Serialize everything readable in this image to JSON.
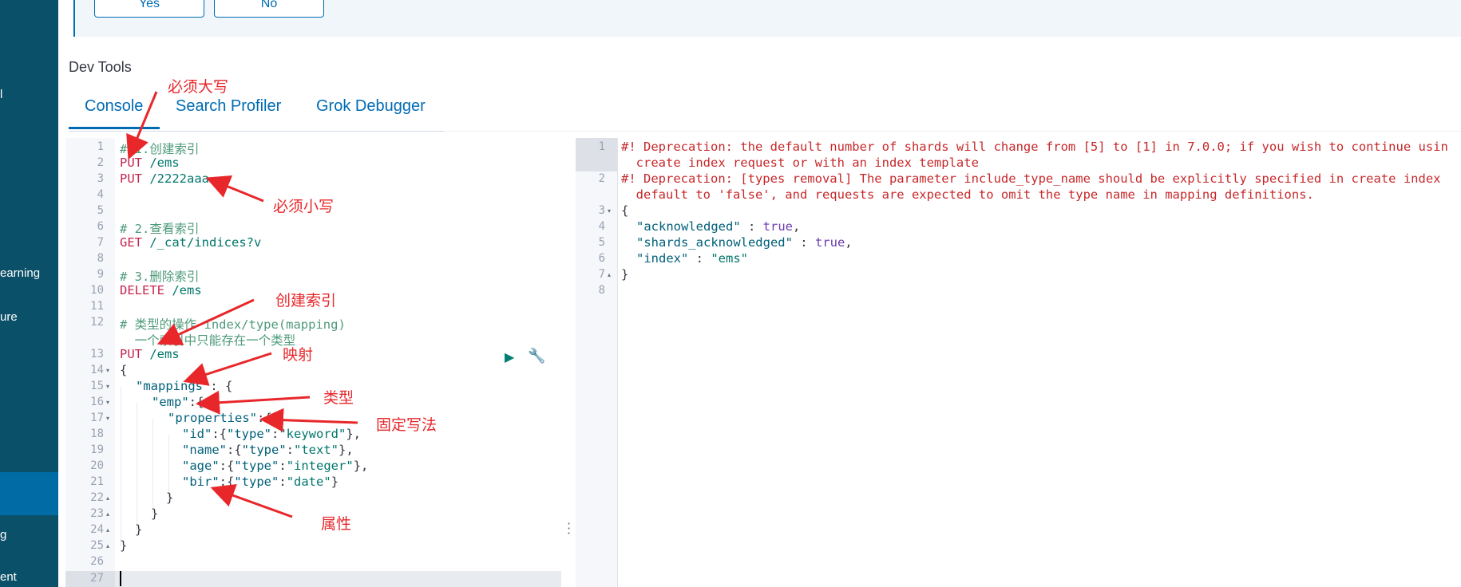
{
  "sidebar": {
    "items": [
      {
        "label": "l"
      },
      {
        "label": "earning"
      },
      {
        "label": "ure"
      },
      {
        "label": "g"
      },
      {
        "label": "ent"
      }
    ]
  },
  "callout": {
    "yes_label": "Yes",
    "no_label": "No"
  },
  "page_title": "Dev Tools",
  "tabs": [
    {
      "label": "Console"
    },
    {
      "label": "Search Profiler"
    },
    {
      "label": "Grok Debugger"
    }
  ],
  "request_editor": {
    "line_numbers": [
      "1",
      "2",
      "3",
      "4",
      "5",
      "6",
      "7",
      "8",
      "9",
      "10",
      "11",
      "12",
      "13",
      "14",
      "15",
      "16",
      "17",
      "18",
      "19",
      "20",
      "21",
      "22",
      "23",
      "24",
      "25",
      "26",
      "27"
    ],
    "lines": {
      "l1": "# 1.创建索引",
      "l2_method": "PUT",
      "l2_path": " /ems",
      "l3_method": "PUT",
      "l3_path": " /2222aaa",
      "l6": "# 2.查看索引",
      "l7_method": "GET",
      "l7_path": " /_cat/indices?v",
      "l9": "# 3.删除索引",
      "l10_method": "DELETE",
      "l10_path": " /ems",
      "l12a": "# 类型的操作 index/type(mapping)",
      "l12b": "  一个索引中只能存在一个类型",
      "l13_method": "PUT",
      "l13_path": " /ems",
      "l14": "{",
      "l15_key": "\"mappings\"",
      "l15_rest": ": {",
      "l16_key": "\"emp\"",
      "l16_rest": ":{",
      "l17_key": "\"properties\"",
      "l17_rest": ":{",
      "l18_key": "\"id\"",
      "l18_p1": ":{",
      "l18_k2": "\"type\"",
      "l18_p2": ":",
      "l18_v": "\"keyword\"",
      "l18_end": "},",
      "l19_key": "\"name\"",
      "l19_p1": ":{",
      "l19_k2": "\"type\"",
      "l19_p2": ":",
      "l19_v": "\"text\"",
      "l19_end": "},",
      "l20_key": "\"age\"",
      "l20_p1": ":{",
      "l20_k2": "\"type\"",
      "l20_p2": ":",
      "l20_v": "\"integer\"",
      "l20_end": "},",
      "l21_key": "\"bir\"",
      "l21_p1": ":{",
      "l21_k2": "\"type\"",
      "l21_p2": ":",
      "l21_v": "\"date\"",
      "l21_end": "}",
      "l22": "}",
      "l23": "}",
      "l24": "}",
      "l25": "}"
    }
  },
  "response_editor": {
    "line_numbers": [
      "1",
      "2",
      "3",
      "4",
      "5",
      "6",
      "7",
      "8"
    ],
    "l1a": "#! Deprecation: the default number of shards will change from [5] to [1] in 7.0.0; if you wish to continue usin",
    "l1b": "  create index request or with an index template",
    "l2a": "#! Deprecation: [types removal] The parameter include_type_name should be explicitly specified in create index",
    "l2b": "  default to 'false', and requests are expected to omit the type name in mapping definitions.",
    "l3": "{",
    "l4_key": "\"acknowledged\"",
    "l4_sep": " : ",
    "l4_val": "true",
    "l4_end": ",",
    "l5_key": "\"shards_acknowledged\"",
    "l5_sep": " : ",
    "l5_val": "true",
    "l5_end": ",",
    "l6_key": "\"index\"",
    "l6_sep": " : ",
    "l6_val": "\"ems\"",
    "l7": "}"
  },
  "annotations": {
    "uppercase": "必须大写",
    "lowercase": "必须小写",
    "create_index": "创建索引",
    "mapping": "映射",
    "type": "类型",
    "fixed": "固定写法",
    "properties": "属性"
  },
  "colors": {
    "sidebar": "#0b5069",
    "accent": "#006bb4",
    "annotation": "#e8272b"
  }
}
